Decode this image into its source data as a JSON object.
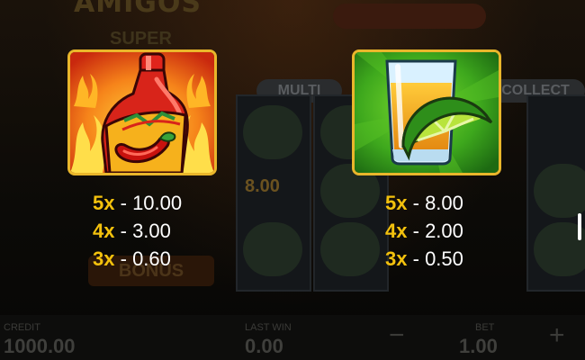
{
  "background": {
    "game_title": "AMIGOS",
    "title_sub": "SUPER",
    "pill_multi": "MULTI",
    "pill_collect": "COLLECT",
    "value_coin": "8.00",
    "bonus_label": "BONUS",
    "credit_label": "CREDIT",
    "credit_value": "1000.00",
    "last_win_label": "LAST WIN",
    "last_win_value": "0.00",
    "bet_label": "BET",
    "bet_value": "1.00"
  },
  "symbols": [
    {
      "icon": "hot-sauce-bottle-icon",
      "frame_color": "#e9b62b",
      "payouts": [
        {
          "mult": "5x",
          "dash": "-",
          "value": "10.00"
        },
        {
          "mult": "4x",
          "dash": "-",
          "value": "3.00"
        },
        {
          "mult": "3x",
          "dash": "-",
          "value": "0.60"
        }
      ]
    },
    {
      "icon": "tequila-shot-lime-icon",
      "frame_color": "#e9b62b",
      "payouts": [
        {
          "mult": "5x",
          "dash": "-",
          "value": "8.00"
        },
        {
          "mult": "4x",
          "dash": "-",
          "value": "2.00"
        },
        {
          "mult": "3x",
          "dash": "-",
          "value": "0.50"
        }
      ]
    }
  ],
  "colors": {
    "multiplier": "#f3c10d",
    "payout_value": "#ffffff",
    "frame_gold": "#e9b62b"
  }
}
